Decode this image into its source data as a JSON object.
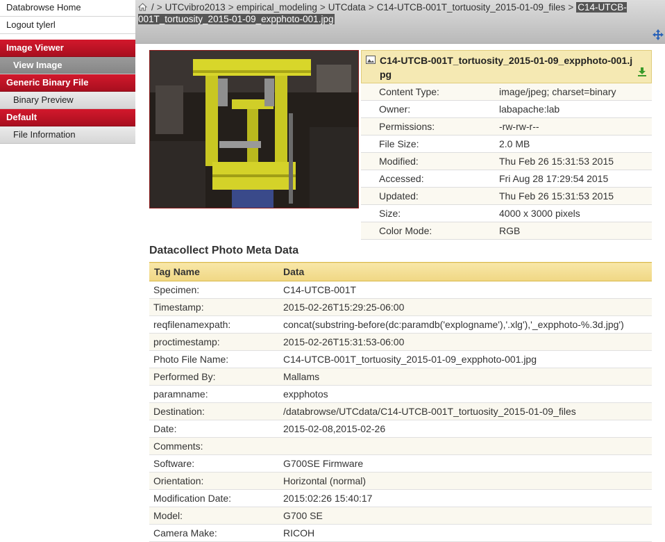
{
  "sidebar": {
    "top_links": [
      "Databrowse Home",
      "Logout tylerl"
    ],
    "sections": [
      {
        "header": "Image Viewer",
        "items": [
          {
            "label": "View Image",
            "active": true
          }
        ]
      },
      {
        "header": "Generic Binary File",
        "items": [
          {
            "label": "Binary Preview",
            "active": false
          }
        ]
      },
      {
        "header": "Default",
        "items": [
          {
            "label": "File Information",
            "active": false
          }
        ]
      }
    ]
  },
  "breadcrumb": {
    "root": "/",
    "items": [
      "UTCvibro2013",
      "empirical_modeling",
      "UTCdata",
      "C14-UTCB-001T_tortuosity_2015-01-09_files"
    ],
    "current": "C14-UTCB-001T_tortuosity_2015-01-09_expphoto-001.jpg",
    "separator": ">"
  },
  "file_info": {
    "title": "C14-UTCB-001T_tortuosity_2015-01-09_expphoto-001.jpg",
    "rows": [
      {
        "key": "Content Type:",
        "value": "image/jpeg; charset=binary"
      },
      {
        "key": "Owner:",
        "value": "labapache:lab"
      },
      {
        "key": "Permissions:",
        "value": "-rw-rw-r--"
      },
      {
        "key": "File Size:",
        "value": "2.0 MB"
      },
      {
        "key": "Modified:",
        "value": "Thu Feb 26 15:31:53 2015"
      },
      {
        "key": "Accessed:",
        "value": "Fri Aug 28 17:29:54 2015"
      },
      {
        "key": "Updated:",
        "value": "Thu Feb 26 15:31:53 2015"
      },
      {
        "key": "Size:",
        "value": "4000 x 3000 pixels"
      },
      {
        "key": "Color Mode:",
        "value": "RGB"
      }
    ]
  },
  "metadata": {
    "heading": "Datacollect Photo Meta Data",
    "columns": [
      "Tag Name",
      "Data"
    ],
    "rows": [
      {
        "tag": "Specimen:",
        "data": "C14-UTCB-001T"
      },
      {
        "tag": "Timestamp:",
        "data": "2015-02-26T15:29:25-06:00"
      },
      {
        "tag": "reqfilenamexpath:",
        "data": "concat(substring-before(dc:paramdb('explogname'),'.xlg'),'_expphoto-%.3d.jpg')"
      },
      {
        "tag": "proctimestamp:",
        "data": "2015-02-26T15:31:53-06:00"
      },
      {
        "tag": "Photo File Name:",
        "data": "C14-UTCB-001T_tortuosity_2015-01-09_expphoto-001.jpg"
      },
      {
        "tag": "Performed By:",
        "data": "Mallams"
      },
      {
        "tag": "paramname:",
        "data": "expphotos"
      },
      {
        "tag": "Destination:",
        "data": "/databrowse/UTCdata/C14-UTCB-001T_tortuosity_2015-01-09_files"
      },
      {
        "tag": "Date:",
        "data": "2015-02-08,2015-02-26"
      },
      {
        "tag": "Comments:",
        "data": ""
      },
      {
        "tag": "Software:",
        "data": "G700SE Firmware"
      },
      {
        "tag": "Orientation:",
        "data": "Horizontal (normal)"
      },
      {
        "tag": "Modification Date:",
        "data": "2015:02:26 15:40:17"
      },
      {
        "tag": "Model:",
        "data": "G700 SE"
      },
      {
        "tag": "Camera Make:",
        "data": "RICOH"
      }
    ]
  },
  "colors": {
    "section_header": "#c41427",
    "active_item": "#8f8f8f",
    "info_title_bg": "#f5e9b3",
    "table_header_bg": "#f3dc8f"
  },
  "icons": {
    "breadcrumb_home": "home-icon",
    "expand": "expand-arrows-icon",
    "file": "image-file-icon",
    "download": "download-icon"
  }
}
